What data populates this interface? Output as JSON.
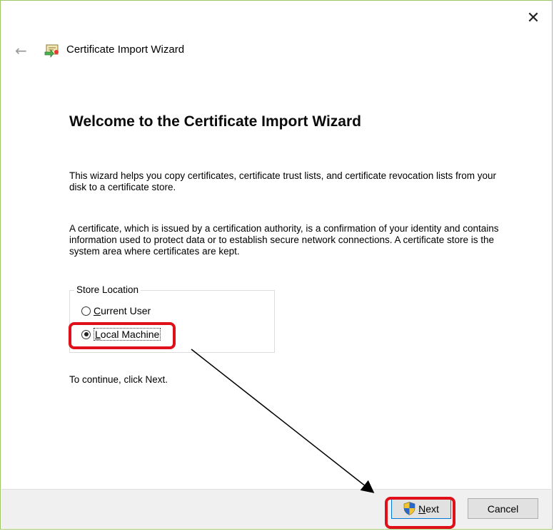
{
  "window": {
    "close_glyph": "✕",
    "back_glyph": "←",
    "title": "Certificate Import Wizard",
    "border_color": "#9bc76a"
  },
  "content": {
    "heading": "Welcome to the Certificate Import Wizard",
    "paragraph1": "This wizard helps you copy certificates, certificate trust lists, and certificate revocation lists from your disk to a certificate store.",
    "paragraph2": "A certificate, which is issued by a certification authority, is a confirmation of your identity and contains information used to protect data or to establish secure network connections. A certificate store is the system area where certificates are kept.",
    "store_location": {
      "label": "Store Location",
      "options": [
        {
          "label_first": "C",
          "label_rest": "urrent User",
          "selected": false
        },
        {
          "label_first": "L",
          "label_rest": "ocal Machine",
          "selected": true
        }
      ]
    },
    "continue_text": "To continue, click Next."
  },
  "footer": {
    "next_first": "N",
    "next_rest": "ext",
    "cancel_label": "Cancel"
  },
  "icons": {
    "back": "arrow-left-icon",
    "wizard": "certificate-wizard-icon",
    "shield": "uac-shield-icon",
    "close": "close-icon"
  },
  "colors": {
    "annotation_red": "#e0101a",
    "footer_bg": "#f0f0f0",
    "accent_blue": "#0078d7"
  }
}
